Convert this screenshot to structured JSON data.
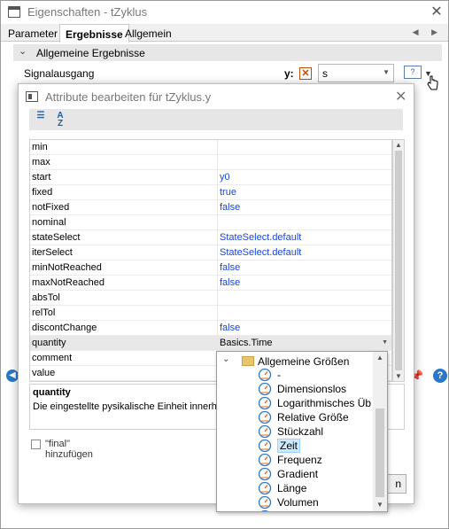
{
  "window": {
    "title": "Eigenschaften - tZyklus",
    "close": "✕",
    "tabs": [
      "Parameter",
      "Ergebnisse",
      "Allgemein"
    ],
    "tab_arrows": "◀ ▶"
  },
  "group": {
    "title": "Allgemeine Ergebnisse",
    "row_label": "Signalausgang",
    "y_label": "y:",
    "x_mark": "✕",
    "unit_value": "s",
    "q_button": "?"
  },
  "dialog": {
    "title": "Attribute bearbeiten für tZyklus.y",
    "close": "✕",
    "attributes": [
      {
        "key": "min",
        "value": ""
      },
      {
        "key": "max",
        "value": ""
      },
      {
        "key": "start",
        "value": "y0"
      },
      {
        "key": "fixed",
        "value": "true"
      },
      {
        "key": "notFixed",
        "value": "false"
      },
      {
        "key": "nominal",
        "value": ""
      },
      {
        "key": "stateSelect",
        "value": "StateSelect.default"
      },
      {
        "key": "iterSelect",
        "value": "StateSelect.default"
      },
      {
        "key": "minNotReached",
        "value": "false"
      },
      {
        "key": "maxNotReached",
        "value": "false"
      },
      {
        "key": "absTol",
        "value": ""
      },
      {
        "key": "relTol",
        "value": ""
      },
      {
        "key": "discontChange",
        "value": "false"
      },
      {
        "key": "quantity",
        "value": "Basics.Time"
      },
      {
        "key": "comment",
        "value": ""
      },
      {
        "key": "value",
        "value": ""
      }
    ],
    "selected_attribute": "quantity",
    "description_title": "quantity",
    "description_text": "Die eingestellte pysikalische Einheit innerhal",
    "final_label": "\"final\" hinzufügen",
    "ok_label": "n"
  },
  "popup": {
    "root": "Allgemeine Größen",
    "items": [
      "-",
      "Dimensionslos",
      "Logarithmisches Üb",
      "Relative Größe",
      "Stückzahl",
      "Zeit",
      "Frequenz",
      "Gradient",
      "Länge",
      "Volumen",
      "M"
    ],
    "selected": "Zeit"
  },
  "colors": {
    "value_blue": "#1a46d8",
    "accent": "#2a78c8",
    "selection": "#cde8ff"
  }
}
